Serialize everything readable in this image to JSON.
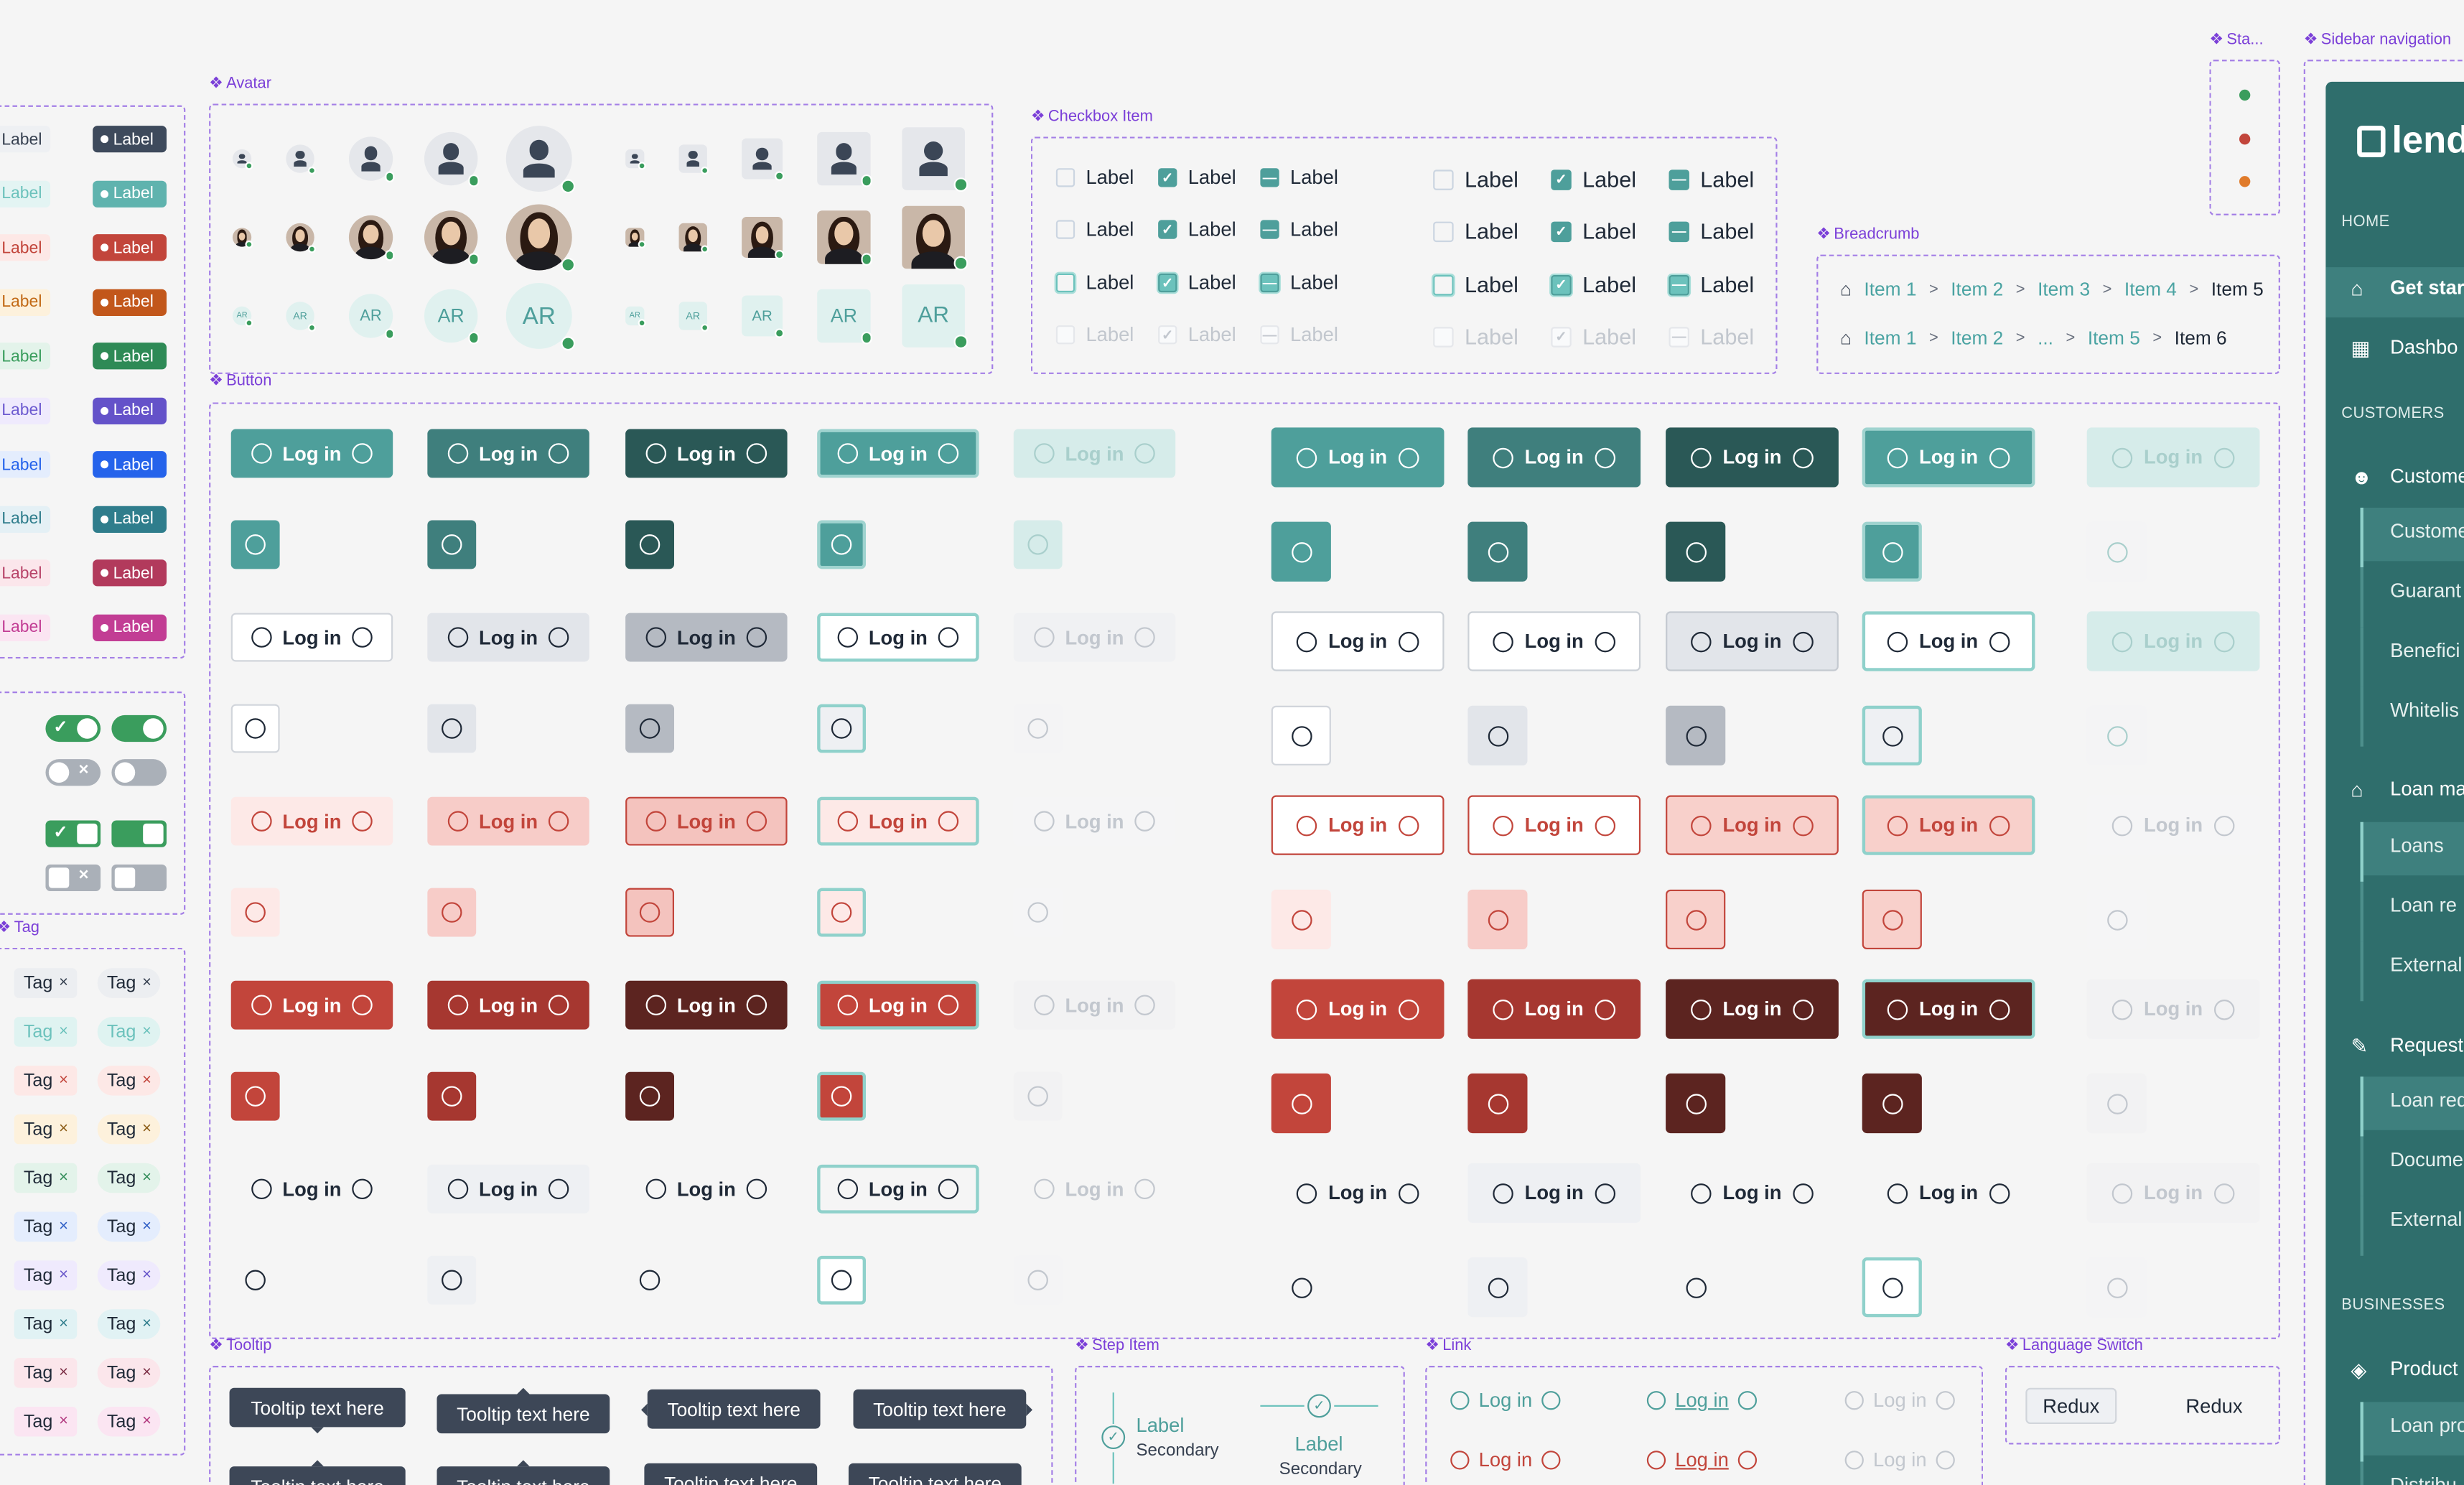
{
  "sections": {
    "avatar": "Avatar",
    "checkbox": "Checkbox Item",
    "breadcrumb": "Breadcrumb",
    "button": "Button",
    "status": "Sta...",
    "sidebar": "Sidebar navigation",
    "tag": "Tag",
    "tooltip": "Tooltip",
    "step": "Step Item",
    "link": "Link",
    "language": "Language Switch"
  },
  "pill_label": "Label",
  "tag_label": "Tag",
  "tag_close": "×",
  "button_label": "Log in",
  "checkbox_label": "Label",
  "avatar_initials": "AR",
  "breadcrumb": {
    "row1": [
      "Item 1",
      "Item 2",
      "Item 3",
      "Item 4",
      "Item 5"
    ],
    "row2": [
      "Item 1",
      "Item 2",
      "...",
      "Item 5",
      "Item 6"
    ],
    "separator": ">"
  },
  "tooltip_text": "Tooltip text here",
  "step": {
    "label": "Label",
    "secondary": "Secondary"
  },
  "link_label": "Log in",
  "language": {
    "active": "Redux",
    "inactive": "Redux"
  },
  "sidebar": {
    "logo": "lend",
    "sections": [
      "HOME",
      "CUSTOMERS",
      "BUSINESSES"
    ],
    "items": [
      "Get start",
      "Dashbo",
      "Custome",
      "Loan ma",
      "Request",
      "Product"
    ],
    "sub_items": [
      "Custome",
      "Guarant",
      "Benefici",
      "Whitelis",
      "Loans",
      "Loan re",
      "External",
      "Loan req",
      "Docume",
      "External",
      "Loan pro",
      "Distribu"
    ]
  },
  "colors": {
    "accent": "#4e9f9b",
    "sidebar": "#2f6e6c",
    "danger": "#c2453b",
    "success": "#3a9d5d",
    "frame": "#a47fe6"
  },
  "status_dots": [
    "#3a9d5d",
    "#c2453b",
    "#e07b2b"
  ]
}
